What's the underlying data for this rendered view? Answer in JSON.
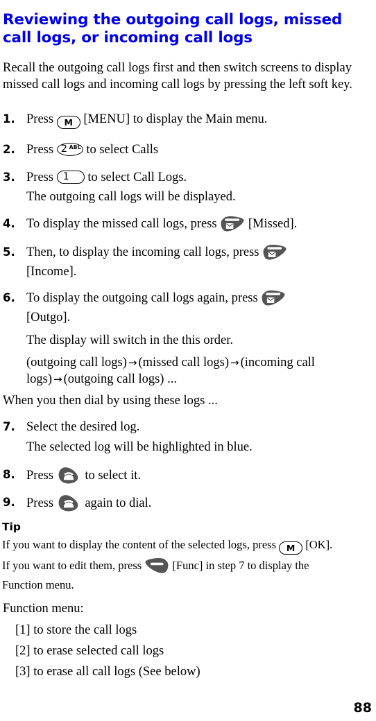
{
  "document": {
    "title": "Reviewing the outgoing call logs, missed call logs, or incoming call logs",
    "page_number": "88",
    "title_color": "#0000ee"
  },
  "intro": {
    "text": "Recall the outgoing call logs first and then switch screens to display missed call logs and incoming call logs by pressing the left soft key."
  },
  "steps": [
    {
      "number": "1.",
      "text_before": "Press",
      "key": "menu-key-M",
      "text_after": "[MENU] to display the Main menu."
    },
    {
      "number": "2.",
      "text_before": "Press",
      "key": "digit-key-2-abc",
      "text_after": "to select Calls"
    },
    {
      "number": "3.",
      "text_before": "Press",
      "key": "digit-key-1",
      "text_after": "to select Call Logs.",
      "note": "The outgoing call logs will be displayed."
    },
    {
      "number": "4.",
      "text_before": "To display the missed call logs, press",
      "key": "left-soft-key",
      "text_after": "[Missed]."
    },
    {
      "number": "5.",
      "text_before": "Then, to display the incoming call logs, press",
      "key": "left-soft-key",
      "text_after": "[Income]."
    },
    {
      "number": "6.",
      "text_before": "To display the outgoing call logs again, press",
      "key": "left-soft-key",
      "text_after": "[Outgo].",
      "note": "The display will switch in the this order.",
      "sequence": "(outgoing call logs) → (missed call logs) → (incoming call logs) → (outgoing call logs) ..."
    },
    {
      "number": "7.",
      "text_before": "Select the desired log.",
      "note": "The selected log will be highlighted in blue."
    },
    {
      "number": "8.",
      "text_before": "Press",
      "key": "send-call-key",
      "text_after": "to select it."
    },
    {
      "number": "9.",
      "text_before": "Press",
      "key": "send-call-key",
      "text_after": "again to dial."
    }
  ],
  "sequence_parts": {
    "p1": "(outgoing call logs)",
    "arrow1": "→",
    "p2": "(missed call logs)",
    "arrow2": "→",
    "p3": "(incoming call",
    "p4": "logs)",
    "arrow3": "→",
    "p5": "(outgoing call logs) ..."
  },
  "transition_text": "When you then dial by using these logs ...",
  "tip": {
    "label": "Tip",
    "line1_before": "If you want to display the content of the selected logs, press",
    "line1_key": "menu-key-M",
    "line1_after": "[OK].",
    "line2_before": "If you want to edit them, press",
    "line2_key": "right-soft-key",
    "line2_after": "[Func] in step 7 to display the",
    "line3": "Function menu."
  },
  "function_menu": {
    "heading": "Function menu:",
    "items": [
      "[1] to store the call logs",
      "[2] to erase selected call logs",
      "[3] to erase all call logs (See below)"
    ]
  },
  "key_glyphs": {
    "menu_letter": "M",
    "digit_two": "2",
    "digit_two_letters": "ABC",
    "digit_one": "1"
  }
}
